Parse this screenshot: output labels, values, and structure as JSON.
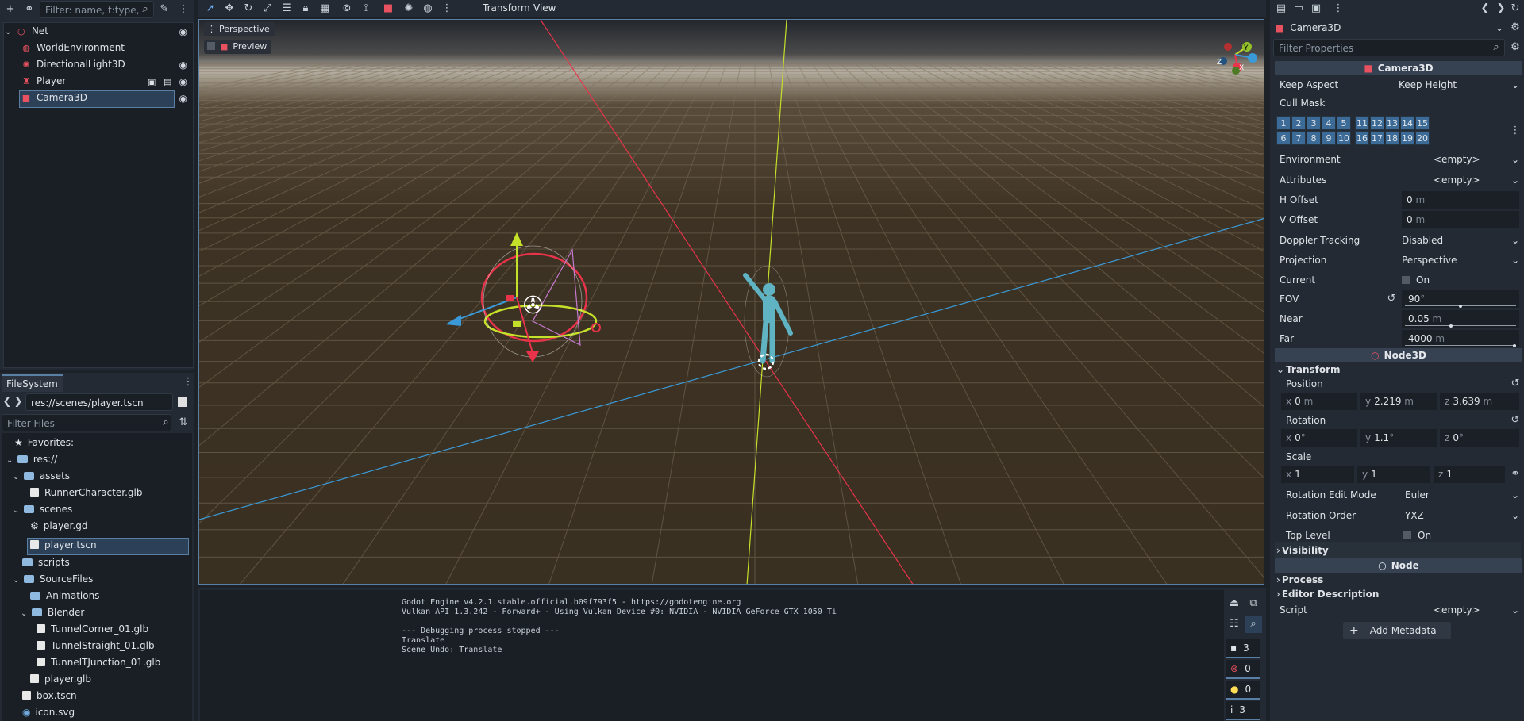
{
  "scene_panel": {
    "filter_placeholder": "Filter: name, t:type, g:gr",
    "nodes": [
      {
        "name": "Net",
        "icon": "node3d-icon"
      },
      {
        "name": "WorldEnvironment",
        "icon": "world-environment-icon"
      },
      {
        "name": "DirectionalLight3D",
        "icon": "light-icon"
      },
      {
        "name": "Player",
        "icon": "player-icon"
      },
      {
        "name": "Camera3D",
        "icon": "camera-icon"
      }
    ]
  },
  "filesystem": {
    "tab_label": "FileSystem",
    "path": "res://scenes/player.tscn",
    "filter_placeholder": "Filter Files",
    "favorites_label": "Favorites:",
    "items": [
      {
        "label": "res://"
      },
      {
        "label": "assets"
      },
      {
        "label": "RunnerCharacter.glb"
      },
      {
        "label": "scenes"
      },
      {
        "label": "player.gd"
      },
      {
        "label": "player.tscn"
      },
      {
        "label": "scripts"
      },
      {
        "label": "SourceFiles"
      },
      {
        "label": "Animations"
      },
      {
        "label": "Blender"
      },
      {
        "label": "TunnelCorner_01.glb"
      },
      {
        "label": "TunnelStraight_01.glb"
      },
      {
        "label": "TunnelTJunction_01.glb"
      },
      {
        "label": "player.glb"
      },
      {
        "label": "box.tscn"
      },
      {
        "label": "icon.svg"
      }
    ]
  },
  "viewport": {
    "menu_transform": "Transform",
    "menu_view": "View",
    "perspective_label": "Perspective",
    "preview_label": "Preview"
  },
  "output": {
    "lines": [
      "Godot Engine v4.2.1.stable.official.b09f793f5 - https://godotengine.org",
      "Vulkan API 1.3.242 - Forward+ - Using Vulkan Device #0: NVIDIA - NVIDIA GeForce GTX 1050 Ti",
      "",
      "--- Debugging process stopped ---",
      "Translate",
      "Scene Undo: Translate"
    ],
    "counts": {
      "messages": "3",
      "errors": "0",
      "warnings": "0",
      "info": "3"
    }
  },
  "inspector": {
    "node_name": "Camera3D",
    "filter_placeholder": "Filter Properties",
    "section_camera": "Camera3D",
    "keep_aspect": {
      "label": "Keep Aspect",
      "value": "Keep Height"
    },
    "cull_mask_label": "Cull Mask",
    "cull_layers": [
      "1",
      "2",
      "3",
      "4",
      "5",
      "11",
      "12",
      "13",
      "14",
      "15",
      "6",
      "7",
      "8",
      "9",
      "10",
      "16",
      "17",
      "18",
      "19",
      "20"
    ],
    "environment": {
      "label": "Environment",
      "value": "<empty>"
    },
    "attributes": {
      "label": "Attributes",
      "value": "<empty>"
    },
    "h_offset": {
      "label": "H Offset",
      "value": "0",
      "unit": "m"
    },
    "v_offset": {
      "label": "V Offset",
      "value": "0",
      "unit": "m"
    },
    "doppler": {
      "label": "Doppler Tracking",
      "value": "Disabled"
    },
    "projection": {
      "label": "Projection",
      "value": "Perspective"
    },
    "current": {
      "label": "Current",
      "value": "On"
    },
    "fov": {
      "label": "FOV",
      "value": "90",
      "unit": "°"
    },
    "near": {
      "label": "Near",
      "value": "0.05",
      "unit": "m"
    },
    "far": {
      "label": "Far",
      "value": "4000",
      "unit": "m"
    },
    "section_node3d": "Node3D",
    "transform_label": "Transform",
    "position": {
      "label": "Position",
      "x": "0",
      "y": "2.219",
      "z": "3.639",
      "unit": "m"
    },
    "rotation": {
      "label": "Rotation",
      "x": "0",
      "y": "1.1",
      "z": "0",
      "unit": "°"
    },
    "scale": {
      "label": "Scale",
      "x": "1",
      "y": "1",
      "z": "1"
    },
    "rotation_edit_mode": {
      "label": "Rotation Edit Mode",
      "value": "Euler"
    },
    "rotation_order": {
      "label": "Rotation Order",
      "value": "YXZ"
    },
    "top_level": {
      "label": "Top Level",
      "value": "On"
    },
    "visibility_label": "Visibility",
    "section_node": "Node",
    "process_label": "Process",
    "editor_description_label": "Editor Description",
    "script": {
      "label": "Script",
      "value": "<empty>"
    },
    "add_metadata_label": "Add Metadata"
  },
  "colors": {
    "accent": "#5a7fa5",
    "ground": "#3a3022",
    "sky_top": "#23272d",
    "x_axis": "#e8334a",
    "y_axis": "#c5e02a",
    "z_axis": "#3a9ad8",
    "character": "#5fb3c2"
  }
}
